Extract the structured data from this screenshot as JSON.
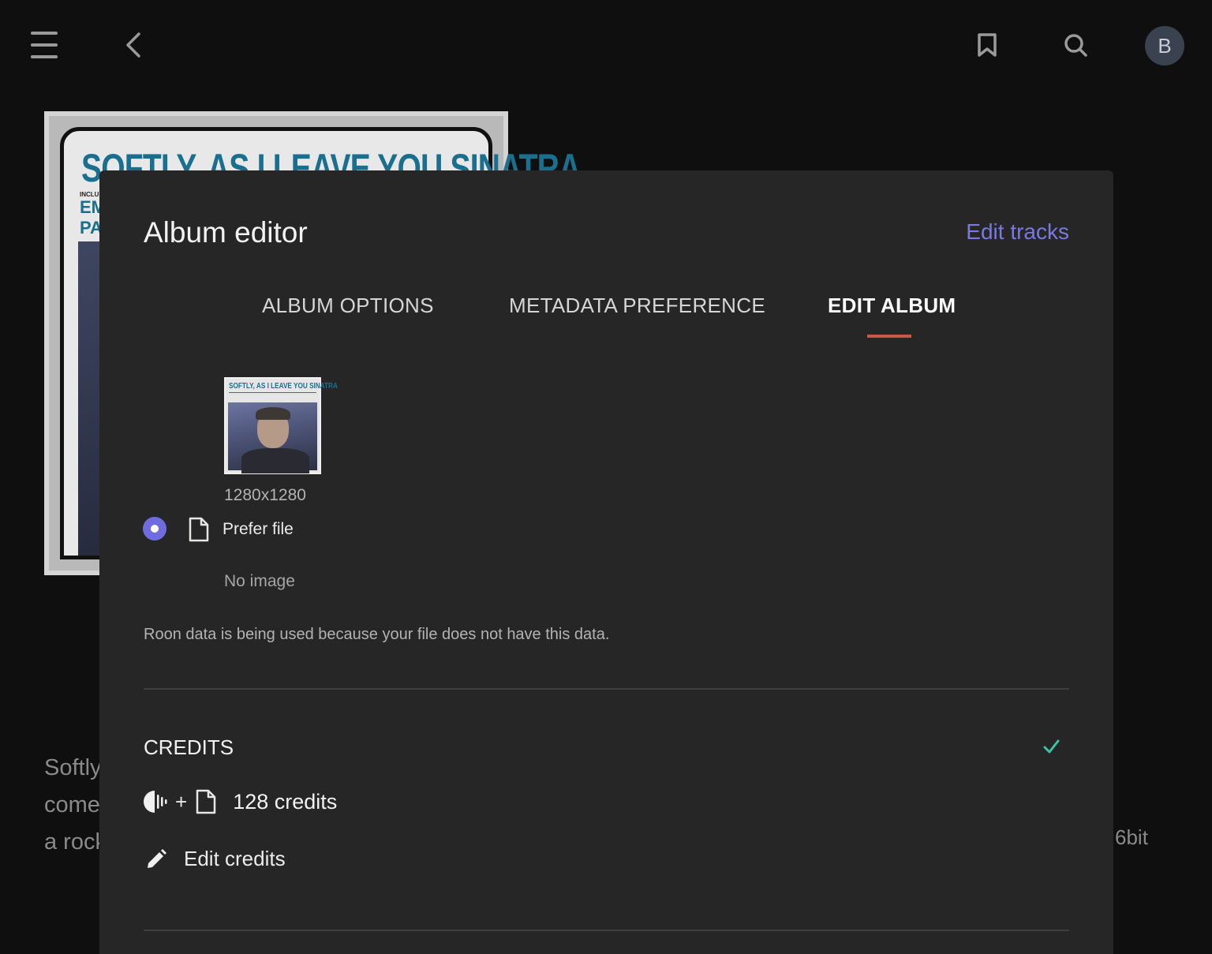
{
  "topbar": {
    "avatar_initial": "B"
  },
  "background": {
    "cover_title": "SOFTLY, AS I LEAVE YOU SINATRA",
    "cover_sub_small": "INCLUDING",
    "cover_sub_lines": [
      "EM",
      "PA"
    ],
    "text_lines": [
      "Softly",
      "come",
      "a rock"
    ],
    "right_fragment": "6bit"
  },
  "dialog": {
    "title": "Album editor",
    "edit_tracks_label": "Edit tracks",
    "tabs": [
      {
        "label": "ALBUM OPTIONS",
        "active": false
      },
      {
        "label": "METADATA PREFERENCE",
        "active": false
      },
      {
        "label": "EDIT ALBUM",
        "active": true
      }
    ],
    "image": {
      "thumb_title": "SOFTLY, AS I LEAVE YOU SINATRA",
      "resolution": "1280x1280",
      "option_label": "Prefer file",
      "alt_option_label": "No image",
      "note": "Roon data is being used because your file does not have this data."
    },
    "credits": {
      "heading": "CREDITS",
      "plus": "+",
      "count_label": "128 credits",
      "edit_label": "Edit credits"
    },
    "colors": {
      "accent": "#7b78e0",
      "tab_underline": "#c9574a",
      "check": "#3fc1a5"
    }
  }
}
